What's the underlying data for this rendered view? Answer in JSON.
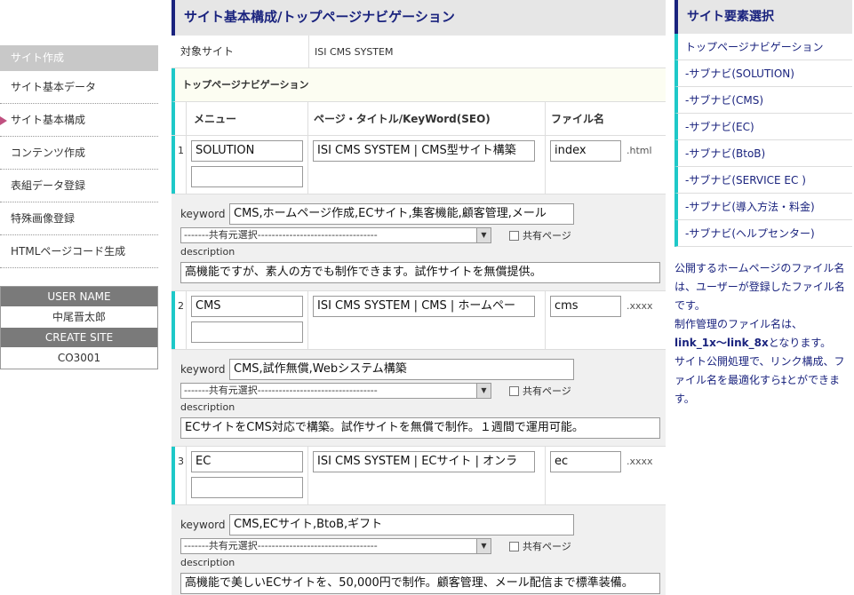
{
  "sidebar": {
    "header": "サイト作成",
    "items": [
      "サイト基本データ",
      "サイト基本構成",
      "コンテンツ作成",
      "表組データ登録",
      "特殊画像登録",
      "HTMLページコード生成"
    ],
    "user_label": "USER NAME",
    "user_name": "中尾晋太郎",
    "create_label": "CREATE SITE",
    "site_code": "CO3001"
  },
  "main": {
    "title": "サイト基本構成/トップページナビゲーション",
    "target_label": "対象サイト",
    "target_value": "ISI CMS SYSTEM",
    "section_title": "トップページナビゲーション",
    "col_menu": "メニュー",
    "col_page": "ページ・タイトル/KeyWord(SEO)",
    "col_file": "ファイル名",
    "keyword_label": "keyword",
    "select_label": "-------共有元選択----------------------------------",
    "shared_label": "共有ページ",
    "description_label": "description",
    "entries": [
      {
        "idx": "1",
        "menu": "SOLUTION",
        "page_title": "ISI CMS SYSTEM | CMS型サイト構築",
        "file": "index",
        "ext": ".html",
        "keywords": "CMS,ホームページ作成,ECサイト,集客機能,顧客管理,メール",
        "description": "高機能ですが、素人の方でも制作できます。試作サイトを無償提供。"
      },
      {
        "idx": "2",
        "menu": "CMS",
        "page_title": "ISI CMS SYSTEM | CMS | ホームペー",
        "file": "cms",
        "ext": ".xxxx",
        "keywords": "CMS,試作無償,Webシステム構築",
        "description": "ECサイトをCMS対応で構築。試作サイトを無償で制作。１週間で運用可能。"
      },
      {
        "idx": "3",
        "menu": "EC",
        "page_title": "ISI CMS SYSTEM | ECサイト | オンラ",
        "file": "ec",
        "ext": ".xxxx",
        "keywords": "CMS,ECサイト,BtoB,ギフト",
        "description": "高機能で美しいECサイトを、50,000円で制作。顧客管理、メール配信まで標準装備。"
      }
    ]
  },
  "right": {
    "title": "サイト要素選択",
    "items": [
      "トップページナビゲーション",
      "-サブナビ(SOLUTION)",
      "-サブナビ(CMS)",
      "-サブナビ(EC)",
      "-サブナビ(BtoB)",
      "-サブナビ(SERVICE EC )",
      "-サブナビ(導入方法・料金)",
      "-サブナビ(ヘルプセンター)"
    ],
    "note_1": "公開するホームページのファイル名は、ユーザーが登録したファイル名です。",
    "note_2": "制作管理のファイル名は、",
    "note_bold": "link_1x〜link_8x",
    "note_3": "となります。",
    "note_4": "サイト公開処理で、リンク構成、ファイル名を最適化すら‡とができます。"
  }
}
